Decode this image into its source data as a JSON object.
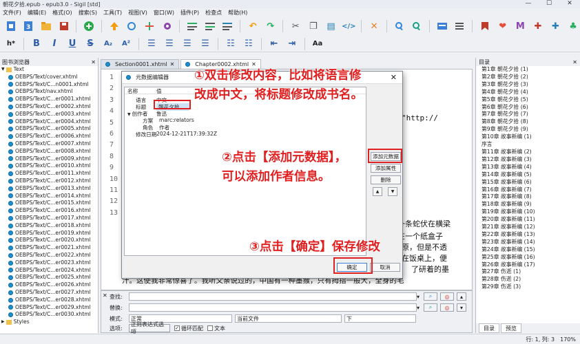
{
  "window": {
    "title": "朝花夕拾.epub - epub3.0 - Sigil [std]",
    "controls": [
      "—",
      "☐",
      "✕"
    ]
  },
  "menu": [
    "文件(F)",
    "编辑(E)",
    "格式(O)",
    "搜索(S)",
    "工具(T)",
    "视图(V)",
    "窗口(W)",
    "插件(P)",
    "检查点",
    "帮助(H)"
  ],
  "toolbar2": {
    "heading": "h*",
    "bold": "B",
    "italic": "I",
    "underline": "U",
    "strike": "S",
    "sub": "A₂",
    "sup": "A²",
    "case": "Aa"
  },
  "left_panel": {
    "title": "图书浏览器",
    "root": "Text",
    "files": [
      "OEBPS/Text/cover.xhtml",
      "OEBPS/Text/C...n0001.xhtml",
      "OEBPS/Text/nav.xhtml",
      "OEBPS/Text/C...er0001.xhtml",
      "OEBPS/Text/C...er0002.xhtml",
      "OEBPS/Text/C...er0003.xhtml",
      "OEBPS/Text/C...er0004.xhtml",
      "OEBPS/Text/C...er0005.xhtml",
      "OEBPS/Text/C...er0006.xhtml",
      "OEBPS/Text/C...er0007.xhtml",
      "OEBPS/Text/C...er0008.xhtml",
      "OEBPS/Text/C...er0009.xhtml",
      "OEBPS/Text/C...er0010.xhtml",
      "OEBPS/Text/C...er0011.xhtml",
      "OEBPS/Text/C...er0012.xhtml",
      "OEBPS/Text/C...er0013.xhtml",
      "OEBPS/Text/C...er0014.xhtml",
      "OEBPS/Text/C...er0015.xhtml",
      "OEBPS/Text/C...er0016.xhtml",
      "OEBPS/Text/C...er0017.xhtml",
      "OEBPS/Text/C...er0018.xhtml",
      "OEBPS/Text/C...er0019.xhtml",
      "OEBPS/Text/C...er0020.xhtml",
      "OEBPS/Text/C...er0021.xhtml",
      "OEBPS/Text/C...er0022.xhtml",
      "OEBPS/Text/C...er0023.xhtml",
      "OEBPS/Text/C...er0024.xhtml",
      "OEBPS/Text/C...er0025.xhtml",
      "OEBPS/Text/C...er0026.xhtml",
      "OEBPS/Text/C...er0027.xhtml",
      "OEBPS/Text/C...er0028.xhtml",
      "OEBPS/Text/C...er0029.xhtml",
      "OEBPS/Text/C...er0030.xhtml"
    ],
    "styles": "Styles"
  },
  "tabs": [
    {
      "label": "Section0001.xhtml"
    },
    {
      "label": "Chapter0002.xhtml"
    }
  ],
  "editor": {
    "line_numbers": [
      "1",
      "2",
      "3",
      "4",
      "5",
      "6",
      "7",
      "8",
      "9",
      "10",
      "11",
      "12",
      "13"
    ],
    "fragments": {
      "http": "\"http://",
      "l14a": "一条蛇伏在横梁",
      "l14b": "在一个纸盒子",
      "l14c": "原，但是不透",
      "l14d": "在饭桌上，便",
      "l14e": "了研着的墨",
      "l15": "汁。这使我非常惊喜了。我听父亲说过的，中国有一种墨猴，只有拇指一般大，全身的毛"
    }
  },
  "find": {
    "find_label": "查找:",
    "replace_label": "替换:",
    "mode_label": "模式:",
    "mode_value": "正常",
    "scope_value": "当前文件",
    "direction_value": "下",
    "options_label": "选项:",
    "regex_button": "正则表达式选项",
    "wrap_label": "循环匹配",
    "text_label": "文本"
  },
  "right_panel": {
    "title": "目录",
    "items": [
      "第1章 朝花夕拾 (1)",
      "第2章 朝花夕拾 (2)",
      "第3章 朝花夕拾 (3)",
      "第4章 朝花夕拾 (4)",
      "第5章 朝花夕拾 (5)",
      "第6章 朝花夕拾 (6)",
      "第7章 朝花夕拾 (7)",
      "第8章 朝花夕拾 (8)",
      "第9章 朝花夕拾 (9)",
      "第10章 故事新编 (1)",
      "序言",
      "第11章 故事新编 (2)",
      "第12章 故事新编 (3)",
      "第13章 故事新编 (4)",
      "第14章 故事新编 (5)",
      "第15章 故事新编 (6)",
      "第16章 故事新编 (7)",
      "第17章 故事新编 (8)",
      "第18章 故事新编 (9)",
      "第19章 故事新编 (10)",
      "第20章 故事新编 (11)",
      "第21章 故事新编 (12)",
      "第22章 故事新编 (13)",
      "第23章 故事新编 (14)",
      "第24章 故事新编 (15)",
      "第25章 故事新编 (16)",
      "第26章 故事新编 (17)",
      "第27章 伤逝 (1)",
      "第28章 伤逝 (2)",
      "第29章 伤逝 (3)"
    ],
    "tab_toc": "目录",
    "tab_preview": "预览"
  },
  "status": {
    "position": "行: 1, 列: 3",
    "zoom": "170%"
  },
  "dialog": {
    "title": "元数据编辑器",
    "col_name": "名称",
    "col_value": "值",
    "rows": [
      {
        "name": "语言",
        "value": "中文"
      },
      {
        "name": "标题",
        "value": "朝花夕拾"
      },
      {
        "name": "创作者",
        "value": "鲁迅"
      },
      {
        "name": "方案",
        "value": "marc:relators"
      },
      {
        "name": "角色",
        "value": "作者"
      },
      {
        "name": "修改日期",
        "value": "2024-12-21T17:39:32Z"
      }
    ],
    "add_metadata": "添加元数据",
    "add_property": "添加属性",
    "delete": "删除",
    "up": "▲",
    "down": "▼",
    "ok": "确定",
    "cancel": "取消"
  },
  "annotations": {
    "a1_line1": "①双击修改内容，比如将语言修",
    "a1_line2": "改成中文，将标题修改成书名。",
    "a2_line1": "②点击【添加元数据】，",
    "a2_line2": "可以添加作者信息。",
    "a3": "③点击【确定】保存修改"
  },
  "colors": {
    "annotation": "#e02020",
    "accent": "#1c8fd0"
  }
}
